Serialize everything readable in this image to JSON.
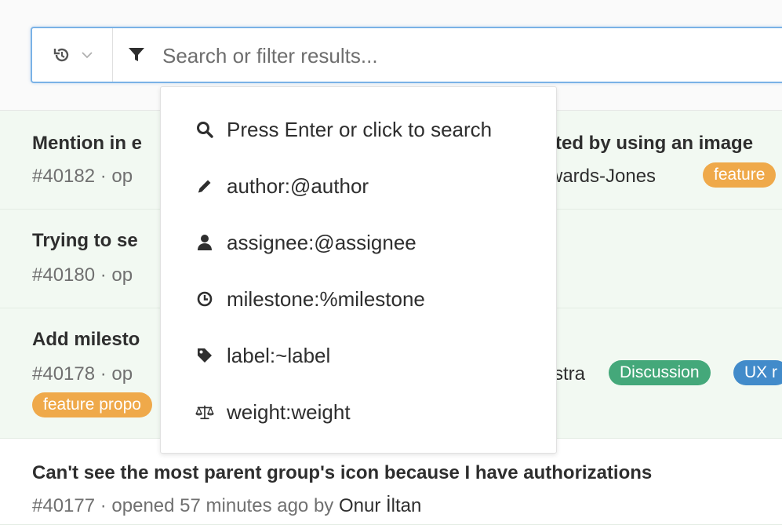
{
  "search": {
    "placeholder": "Search or filter results..."
  },
  "dropdown": {
    "items": [
      {
        "icon": "search-icon",
        "label": "Press Enter or click to search"
      },
      {
        "icon": "pencil-icon",
        "label": "author:@author"
      },
      {
        "icon": "user-icon",
        "label": "assignee:@assignee"
      },
      {
        "icon": "clock-icon",
        "label": "milestone:%milestone"
      },
      {
        "icon": "tag-icon",
        "label": "label:~label"
      },
      {
        "icon": "balance-scale-icon",
        "label": "weight:weight"
      }
    ]
  },
  "issues": [
    {
      "title_left": "Mention in e",
      "title_right": "ted by using an image",
      "meta_left": "#40182 · op",
      "meta_right": "wards-Jones",
      "badges": [
        "feature "
      ]
    },
    {
      "title_left": "Trying to se",
      "meta_left": "#40180 · op"
    },
    {
      "title_left": "Add milesto",
      "meta_left": "#40178 · op",
      "meta_right": "stra",
      "badges": [
        "Discussion",
        "UX r",
        "feature propo"
      ]
    },
    {
      "title": "Can't see the most parent group's icon because I have authorizations",
      "meta_prefix": "#40177 · opened 57 minutes ago by ",
      "author": "Onur İltan"
    }
  ],
  "colors": {
    "search_border": "#7ab2e6",
    "row_green": "#f2f9f2",
    "badge_feature": "#efa94a",
    "badge_discussion": "#44a87a",
    "badge_ux": "#428bca"
  }
}
